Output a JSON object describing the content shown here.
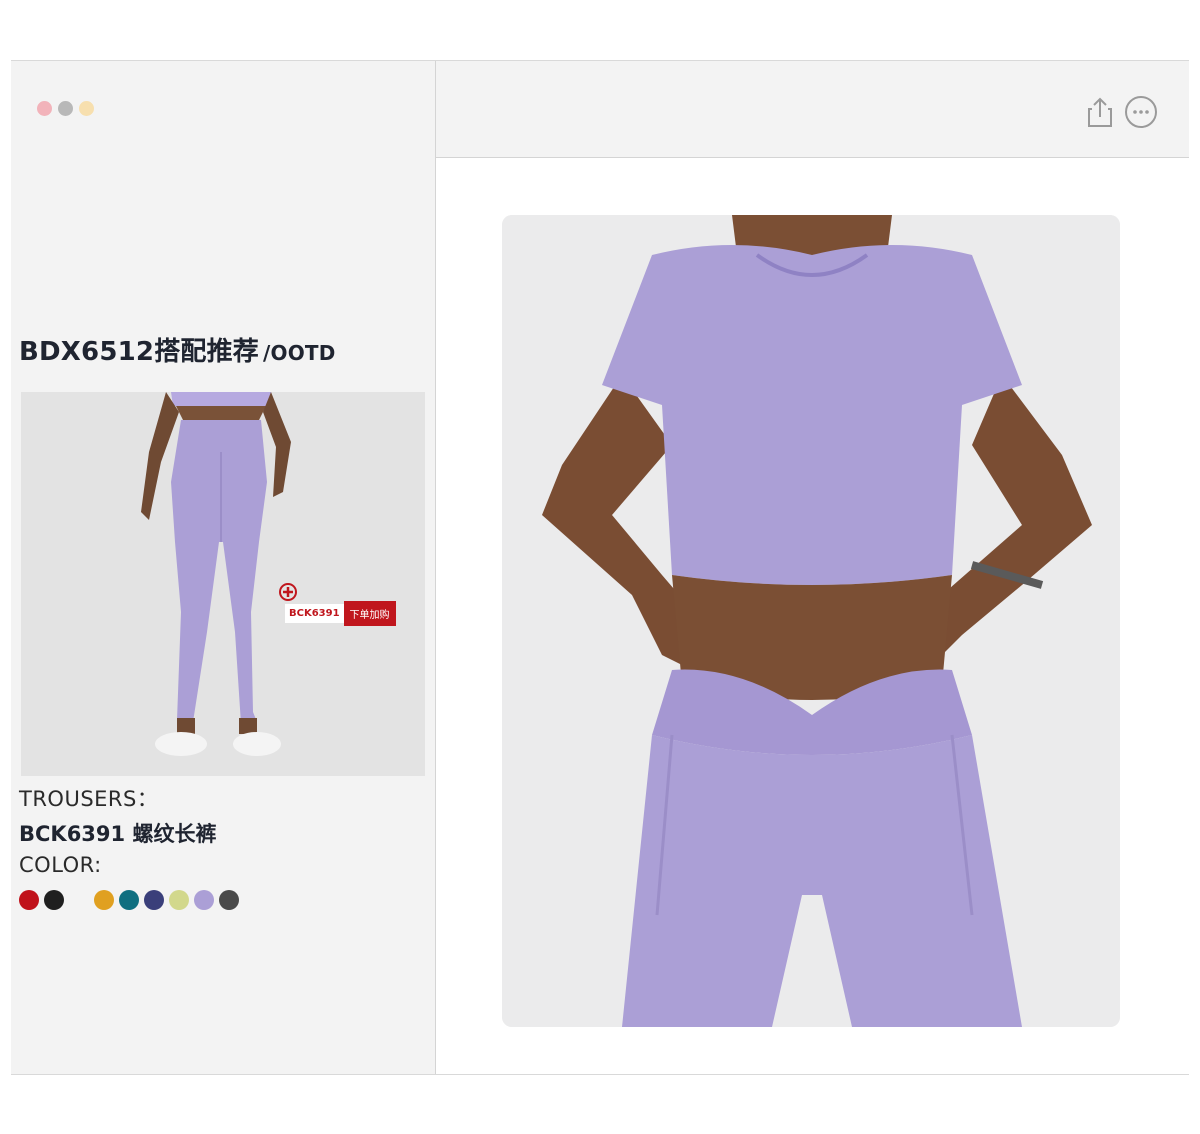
{
  "window": {
    "dots": [
      "#f2b3ba",
      "#b8b8b8",
      "#f7dfae"
    ]
  },
  "header": {
    "share_icon": "share-icon",
    "more_icon": "more-icon"
  },
  "outfit": {
    "title_main": "BDX6512搭配推荐",
    "title_suffix": "/OOTD"
  },
  "product_tag": {
    "code": "BCK6391",
    "buy_label": "下单加购"
  },
  "details": {
    "trousers_label": "TROUSERS：",
    "trousers_name": "BCK6391 螺纹长裤",
    "color_label": "COLOR:"
  },
  "colors": [
    "#c0111a",
    "#1f1f1f",
    "#f3f3f3",
    "#e0a020",
    "#0f6f80",
    "#3a3f7a",
    "#d2d88c",
    "#ab9fd6",
    "#4a4a4a"
  ]
}
